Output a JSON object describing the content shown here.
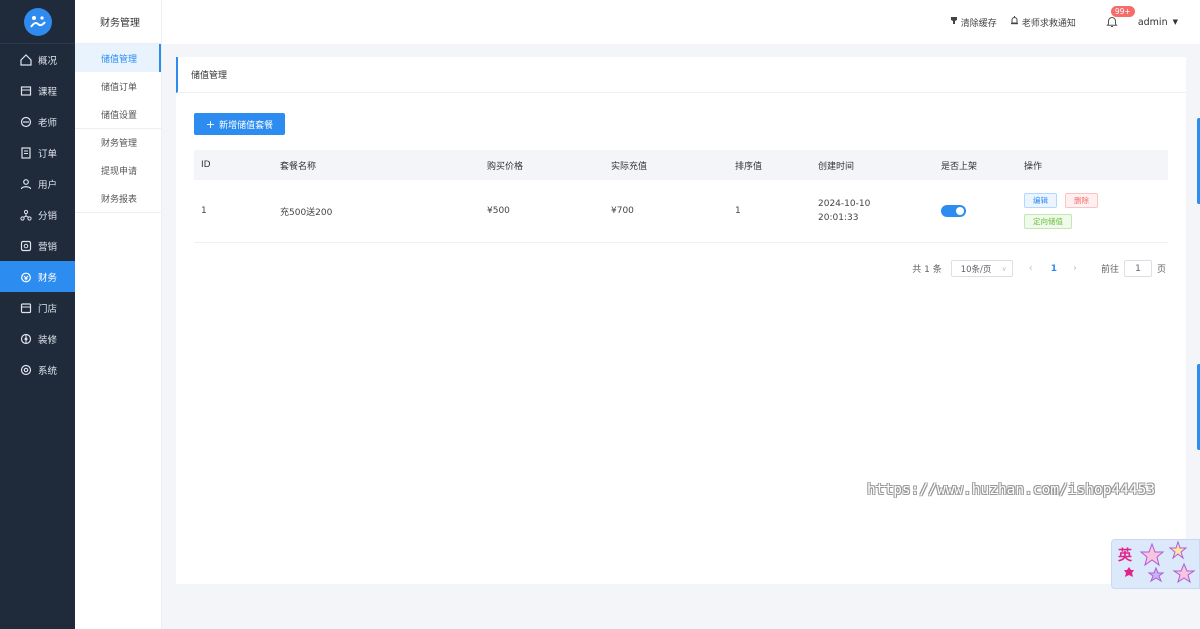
{
  "rail": {
    "items": [
      {
        "label": "概况",
        "icon": "home-icon"
      },
      {
        "label": "课程",
        "icon": "course-icon"
      },
      {
        "label": "老师",
        "icon": "teacher-icon"
      },
      {
        "label": "订单",
        "icon": "order-icon"
      },
      {
        "label": "用户",
        "icon": "user-icon"
      },
      {
        "label": "分销",
        "icon": "distribution-icon"
      },
      {
        "label": "营销",
        "icon": "marketing-icon"
      },
      {
        "label": "财务",
        "icon": "finance-icon",
        "active": true
      },
      {
        "label": "门店",
        "icon": "store-icon"
      },
      {
        "label": "装修",
        "icon": "decoration-icon"
      },
      {
        "label": "系统",
        "icon": "settings-icon"
      }
    ]
  },
  "subnav": {
    "title": "财务管理",
    "items": [
      {
        "label": "储值管理",
        "active": true
      },
      {
        "label": "储值订单"
      },
      {
        "label": "储值设置"
      },
      {
        "label": "财务管理"
      },
      {
        "label": "提现申请"
      },
      {
        "label": "财务报表"
      }
    ]
  },
  "header": {
    "clear_cache": "清除缓存",
    "teacher_notice": "老师求救通知",
    "badge": "99+",
    "user": "admin"
  },
  "card": {
    "title": "储值管理",
    "add_button": "新增储值套餐"
  },
  "table": {
    "columns": [
      "ID",
      "套餐名称",
      "购买价格",
      "实际充值",
      "排序值",
      "创建时间",
      "是否上架",
      "操作"
    ],
    "rows": [
      {
        "id": "1",
        "name": "充500送200",
        "buy_price": "¥500",
        "real_amount": "¥700",
        "sort": "1",
        "created": "2024-10-10\n20:01:33",
        "on_shelf": true,
        "ops": {
          "edit": "编辑",
          "delete": "删除",
          "directed": "定向储值"
        }
      }
    ]
  },
  "pager": {
    "total": "共 1 条",
    "page_size": "10条/页",
    "current": "1",
    "goto_label": "前往",
    "goto_value": "1",
    "page_unit": "页"
  },
  "watermark": "https://www.huzhan.com/ishop44453",
  "widget": {
    "label": "英"
  },
  "colors": {
    "primary": "#2d8cf0",
    "rail_bg": "#1f2a3a",
    "danger": "#f56c6c",
    "success": "#67c23a"
  }
}
